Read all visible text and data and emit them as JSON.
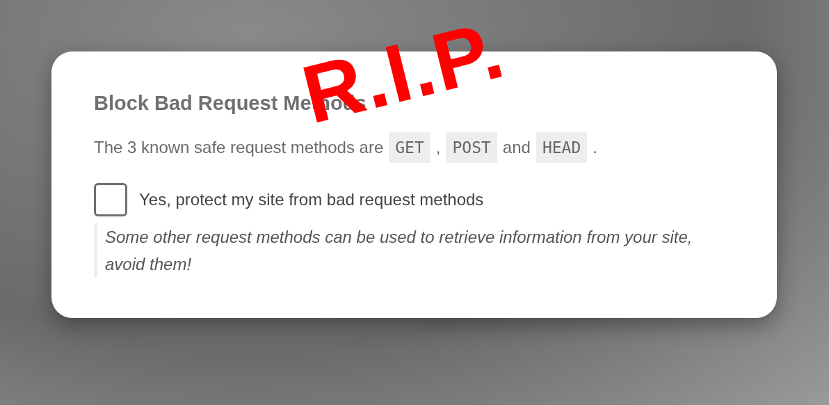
{
  "card": {
    "title": "Block Bad Request Methods",
    "intro": [
      {
        "kind": "text",
        "text": "The 3 known safe request methods are"
      },
      {
        "kind": "code",
        "text": "GET"
      },
      {
        "kind": "text",
        "text": ","
      },
      {
        "kind": "code",
        "text": "POST"
      },
      {
        "kind": "text",
        "text": "and"
      },
      {
        "kind": "code",
        "text": "HEAD"
      },
      {
        "kind": "text",
        "text": "."
      }
    ],
    "option": {
      "label": "Yes, protect my site from bad request methods",
      "checked": false
    },
    "note": "Some other request methods can be used to retrieve information from your site, avoid them!"
  },
  "stamp": "R.I.P."
}
